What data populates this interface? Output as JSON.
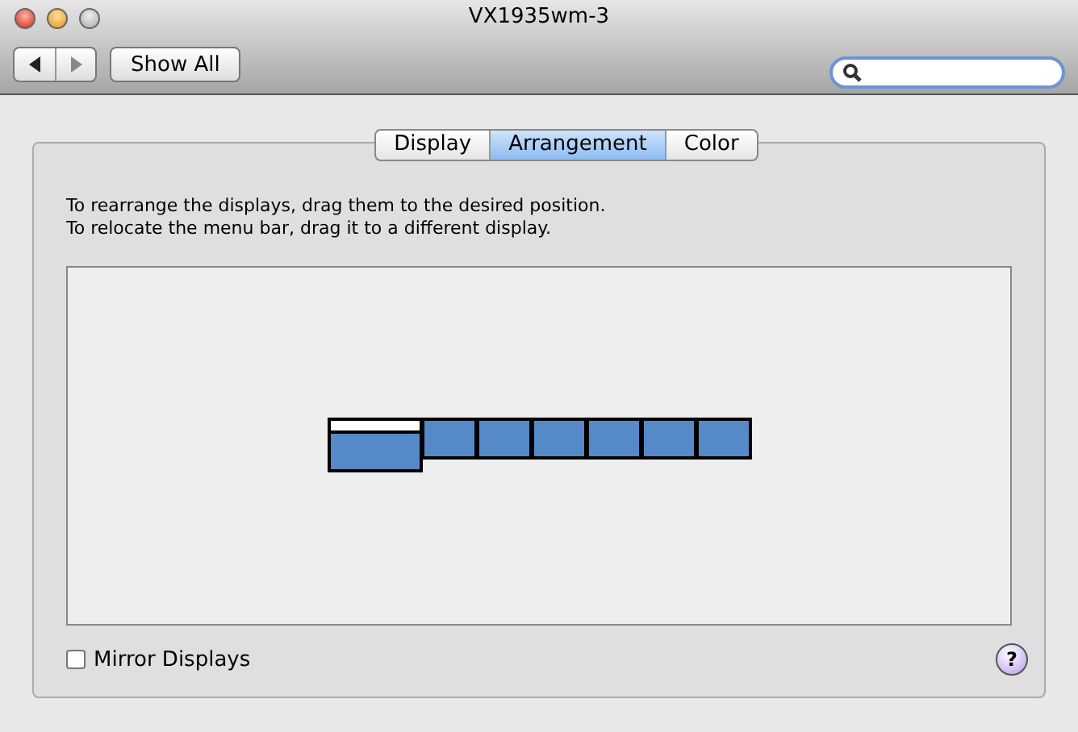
{
  "window": {
    "title": "VX1935wm-3",
    "controls": [
      {
        "kind": "close",
        "disabled": false
      },
      {
        "kind": "minimize",
        "disabled": false
      },
      {
        "kind": "zoom",
        "disabled": true
      }
    ]
  },
  "toolbar": {
    "nav": [
      {
        "kind": "back",
        "disabled": false
      },
      {
        "kind": "forward",
        "disabled": true
      }
    ],
    "show_all": "Show All"
  },
  "tabs": [
    {
      "label": "Display",
      "selected": false
    },
    {
      "label": "Arrangement",
      "selected": true
    },
    {
      "label": "Color",
      "selected": false
    }
  ],
  "instructions": [
    "To rearrange the displays, drag them to the desired position.",
    "To relocate the menu bar, drag it to a different display."
  ],
  "displays": [
    {
      "menu_bar": true
    },
    {
      "menu_bar": false
    },
    {
      "menu_bar": false
    },
    {
      "menu_bar": false
    },
    {
      "menu_bar": false
    },
    {
      "menu_bar": false
    },
    {
      "menu_bar": false
    }
  ],
  "mirror": {
    "label": "Mirror Displays",
    "checked": false
  },
  "help": {
    "label": "?"
  }
}
